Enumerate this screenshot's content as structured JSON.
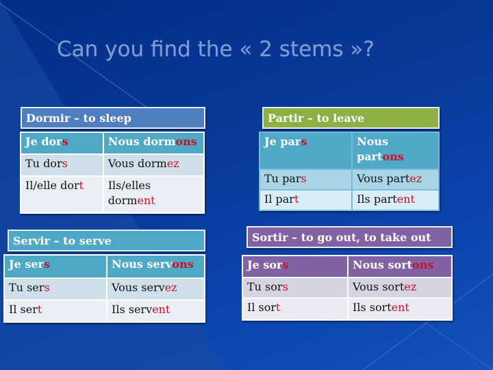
{
  "slide": {
    "title": "Can you find the « 2 stems »?"
  },
  "colors": {
    "ending": "#cc1122",
    "dormir_header": "#4f7fc0",
    "partir_header": "#8db045",
    "servir_header": "#4ea8c6",
    "sortir_header": "#8163a4"
  },
  "verbs": {
    "dormir": {
      "header": "Dormir – to sleep",
      "rows": [
        [
          {
            "stem": "Je dor",
            "end": "s"
          },
          {
            "stem": "Nous dorm",
            "end": "ons"
          }
        ],
        [
          {
            "stem": "Tu dor",
            "end": "s"
          },
          {
            "stem": "Vous dorm",
            "end": "ez"
          }
        ],
        [
          {
            "stem": "Il/elle dor",
            "end": "t"
          },
          {
            "stem": "Ils/elles dorm",
            "end": "ent"
          }
        ]
      ]
    },
    "partir": {
      "header": "Partir – to leave",
      "rows": [
        [
          {
            "stem": "Je par",
            "end": "s"
          },
          {
            "stem": "Nous part",
            "end": "ons"
          }
        ],
        [
          {
            "stem": "Tu par",
            "end": "s"
          },
          {
            "stem": "Vous part",
            "end": "ez"
          }
        ],
        [
          {
            "stem": "Il par",
            "end": "t"
          },
          {
            "stem": "Ils part",
            "end": "ent"
          }
        ]
      ]
    },
    "servir": {
      "header": "Servir – to serve",
      "rows": [
        [
          {
            "stem": "Je ser",
            "end": "s"
          },
          {
            "stem": "Nous serv",
            "end": "ons"
          }
        ],
        [
          {
            "stem": "Tu ser",
            "end": "s"
          },
          {
            "stem": "Vous serv",
            "end": "ez"
          }
        ],
        [
          {
            "stem": "Il ser",
            "end": "t"
          },
          {
            "stem": "Ils serv",
            "end": "ent"
          }
        ]
      ]
    },
    "sortir": {
      "header": "Sortir – to go out, to take out",
      "rows": [
        [
          {
            "stem": "Je sor",
            "end": "s"
          },
          {
            "stem": "Nous sort",
            "end": "ons"
          }
        ],
        [
          {
            "stem": "Tu sor",
            "end": "s"
          },
          {
            "stem": "Vous sort",
            "end": "ez"
          }
        ],
        [
          {
            "stem": "Il sor",
            "end": "t"
          },
          {
            "stem": "Ils sort",
            "end": "ent"
          }
        ]
      ]
    }
  }
}
